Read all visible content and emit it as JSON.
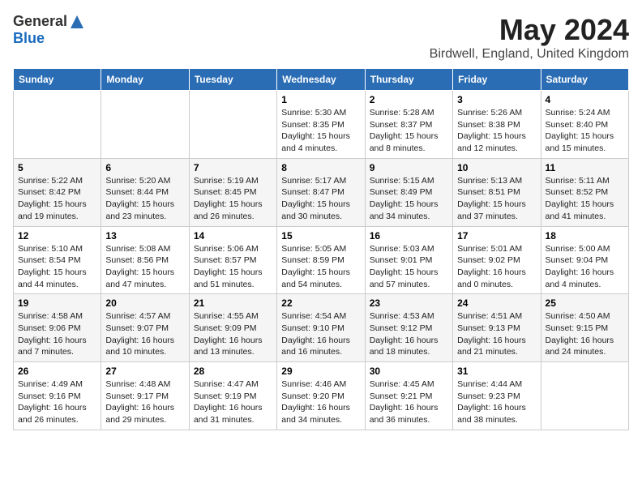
{
  "header": {
    "logo_general": "General",
    "logo_blue": "Blue",
    "title": "May 2024",
    "location": "Birdwell, England, United Kingdom"
  },
  "days_of_week": [
    "Sunday",
    "Monday",
    "Tuesday",
    "Wednesday",
    "Thursday",
    "Friday",
    "Saturday"
  ],
  "weeks": [
    [
      {
        "day": "",
        "sunrise": "",
        "sunset": "",
        "daylight": ""
      },
      {
        "day": "",
        "sunrise": "",
        "sunset": "",
        "daylight": ""
      },
      {
        "day": "",
        "sunrise": "",
        "sunset": "",
        "daylight": ""
      },
      {
        "day": "1",
        "sunrise": "Sunrise: 5:30 AM",
        "sunset": "Sunset: 8:35 PM",
        "daylight": "Daylight: 15 hours and 4 minutes."
      },
      {
        "day": "2",
        "sunrise": "Sunrise: 5:28 AM",
        "sunset": "Sunset: 8:37 PM",
        "daylight": "Daylight: 15 hours and 8 minutes."
      },
      {
        "day": "3",
        "sunrise": "Sunrise: 5:26 AM",
        "sunset": "Sunset: 8:38 PM",
        "daylight": "Daylight: 15 hours and 12 minutes."
      },
      {
        "day": "4",
        "sunrise": "Sunrise: 5:24 AM",
        "sunset": "Sunset: 8:40 PM",
        "daylight": "Daylight: 15 hours and 15 minutes."
      }
    ],
    [
      {
        "day": "5",
        "sunrise": "Sunrise: 5:22 AM",
        "sunset": "Sunset: 8:42 PM",
        "daylight": "Daylight: 15 hours and 19 minutes."
      },
      {
        "day": "6",
        "sunrise": "Sunrise: 5:20 AM",
        "sunset": "Sunset: 8:44 PM",
        "daylight": "Daylight: 15 hours and 23 minutes."
      },
      {
        "day": "7",
        "sunrise": "Sunrise: 5:19 AM",
        "sunset": "Sunset: 8:45 PM",
        "daylight": "Daylight: 15 hours and 26 minutes."
      },
      {
        "day": "8",
        "sunrise": "Sunrise: 5:17 AM",
        "sunset": "Sunset: 8:47 PM",
        "daylight": "Daylight: 15 hours and 30 minutes."
      },
      {
        "day": "9",
        "sunrise": "Sunrise: 5:15 AM",
        "sunset": "Sunset: 8:49 PM",
        "daylight": "Daylight: 15 hours and 34 minutes."
      },
      {
        "day": "10",
        "sunrise": "Sunrise: 5:13 AM",
        "sunset": "Sunset: 8:51 PM",
        "daylight": "Daylight: 15 hours and 37 minutes."
      },
      {
        "day": "11",
        "sunrise": "Sunrise: 5:11 AM",
        "sunset": "Sunset: 8:52 PM",
        "daylight": "Daylight: 15 hours and 41 minutes."
      }
    ],
    [
      {
        "day": "12",
        "sunrise": "Sunrise: 5:10 AM",
        "sunset": "Sunset: 8:54 PM",
        "daylight": "Daylight: 15 hours and 44 minutes."
      },
      {
        "day": "13",
        "sunrise": "Sunrise: 5:08 AM",
        "sunset": "Sunset: 8:56 PM",
        "daylight": "Daylight: 15 hours and 47 minutes."
      },
      {
        "day": "14",
        "sunrise": "Sunrise: 5:06 AM",
        "sunset": "Sunset: 8:57 PM",
        "daylight": "Daylight: 15 hours and 51 minutes."
      },
      {
        "day": "15",
        "sunrise": "Sunrise: 5:05 AM",
        "sunset": "Sunset: 8:59 PM",
        "daylight": "Daylight: 15 hours and 54 minutes."
      },
      {
        "day": "16",
        "sunrise": "Sunrise: 5:03 AM",
        "sunset": "Sunset: 9:01 PM",
        "daylight": "Daylight: 15 hours and 57 minutes."
      },
      {
        "day": "17",
        "sunrise": "Sunrise: 5:01 AM",
        "sunset": "Sunset: 9:02 PM",
        "daylight": "Daylight: 16 hours and 0 minutes."
      },
      {
        "day": "18",
        "sunrise": "Sunrise: 5:00 AM",
        "sunset": "Sunset: 9:04 PM",
        "daylight": "Daylight: 16 hours and 4 minutes."
      }
    ],
    [
      {
        "day": "19",
        "sunrise": "Sunrise: 4:58 AM",
        "sunset": "Sunset: 9:06 PM",
        "daylight": "Daylight: 16 hours and 7 minutes."
      },
      {
        "day": "20",
        "sunrise": "Sunrise: 4:57 AM",
        "sunset": "Sunset: 9:07 PM",
        "daylight": "Daylight: 16 hours and 10 minutes."
      },
      {
        "day": "21",
        "sunrise": "Sunrise: 4:55 AM",
        "sunset": "Sunset: 9:09 PM",
        "daylight": "Daylight: 16 hours and 13 minutes."
      },
      {
        "day": "22",
        "sunrise": "Sunrise: 4:54 AM",
        "sunset": "Sunset: 9:10 PM",
        "daylight": "Daylight: 16 hours and 16 minutes."
      },
      {
        "day": "23",
        "sunrise": "Sunrise: 4:53 AM",
        "sunset": "Sunset: 9:12 PM",
        "daylight": "Daylight: 16 hours and 18 minutes."
      },
      {
        "day": "24",
        "sunrise": "Sunrise: 4:51 AM",
        "sunset": "Sunset: 9:13 PM",
        "daylight": "Daylight: 16 hours and 21 minutes."
      },
      {
        "day": "25",
        "sunrise": "Sunrise: 4:50 AM",
        "sunset": "Sunset: 9:15 PM",
        "daylight": "Daylight: 16 hours and 24 minutes."
      }
    ],
    [
      {
        "day": "26",
        "sunrise": "Sunrise: 4:49 AM",
        "sunset": "Sunset: 9:16 PM",
        "daylight": "Daylight: 16 hours and 26 minutes."
      },
      {
        "day": "27",
        "sunrise": "Sunrise: 4:48 AM",
        "sunset": "Sunset: 9:17 PM",
        "daylight": "Daylight: 16 hours and 29 minutes."
      },
      {
        "day": "28",
        "sunrise": "Sunrise: 4:47 AM",
        "sunset": "Sunset: 9:19 PM",
        "daylight": "Daylight: 16 hours and 31 minutes."
      },
      {
        "day": "29",
        "sunrise": "Sunrise: 4:46 AM",
        "sunset": "Sunset: 9:20 PM",
        "daylight": "Daylight: 16 hours and 34 minutes."
      },
      {
        "day": "30",
        "sunrise": "Sunrise: 4:45 AM",
        "sunset": "Sunset: 9:21 PM",
        "daylight": "Daylight: 16 hours and 36 minutes."
      },
      {
        "day": "31",
        "sunrise": "Sunrise: 4:44 AM",
        "sunset": "Sunset: 9:23 PM",
        "daylight": "Daylight: 16 hours and 38 minutes."
      },
      {
        "day": "",
        "sunrise": "",
        "sunset": "",
        "daylight": ""
      }
    ]
  ]
}
